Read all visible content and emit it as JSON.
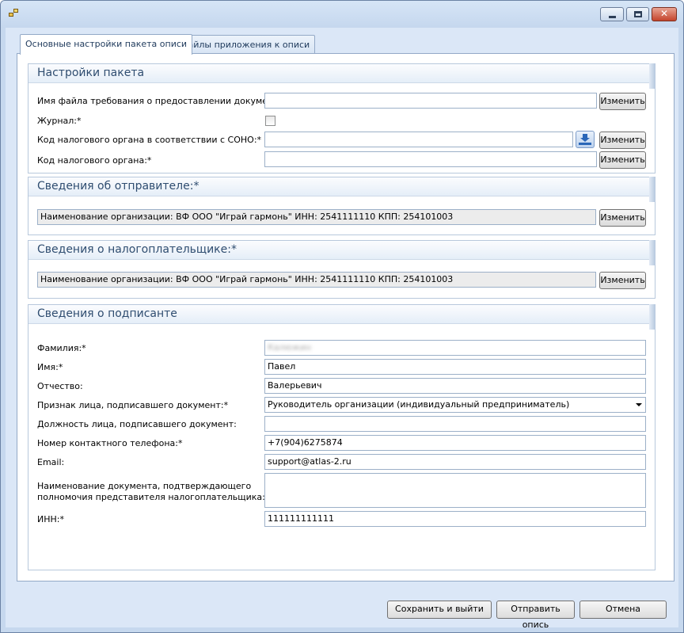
{
  "tabs": [
    "Основные настройки пакета описи",
    "Файлы приложения к описи"
  ],
  "package": {
    "title": "Настройки пакета",
    "fields": {
      "request_file": {
        "label": "Имя файла требования о предоставлении документов:",
        "value": ""
      },
      "journal": {
        "label": "Журнал:*",
        "checked": false
      },
      "tax_code_sono": {
        "label": "Код налогового органа в соответствии с  СОНО:*",
        "value": ""
      },
      "tax_code": {
        "label": "Код налогового органа:*",
        "value": ""
      }
    }
  },
  "sender": {
    "title": "Сведения об отправителе:*",
    "value": "Наименование организации: ВФ ООО \"Играй гармонь\" ИНН: 2541111110 КПП: 254101003"
  },
  "taxpayer": {
    "title": "Сведения о налогоплательщике:*",
    "value": "Наименование организации: ВФ ООО \"Играй гармонь\" ИНН: 2541111110 КПП: 254101003"
  },
  "signer": {
    "title": "Сведения о подписанте",
    "fields": {
      "lastname": {
        "label": "Фамилия:*",
        "value": "Калюжин"
      },
      "firstname": {
        "label": "Имя:*",
        "value": "Павел"
      },
      "patronymic": {
        "label": "Отчество:",
        "value": "Валерьевич"
      },
      "sign_type": {
        "label": "Признак лица, подписавшего документ:*",
        "value": "Руководитель организации (индивидуальный предприниматель)"
      },
      "position": {
        "label": "Должность лица, подписавшего документ:",
        "value": ""
      },
      "phone": {
        "label": "Номер контактного телефона:*",
        "value": "+7(904)6275874"
      },
      "email": {
        "label": "Email:",
        "value": "support@atlas-2.ru"
      },
      "authority_doc": {
        "label1": "Наименование документа, подтверждающего",
        "label2": "полномочия представителя налогоплательщика:",
        "value": ""
      },
      "inn": {
        "label": "ИНН:*",
        "value": "111111111111"
      }
    }
  },
  "buttons": {
    "change": "Изменить",
    "save_exit": "Сохранить и выйти",
    "send": "Отправить опись",
    "cancel": "Отмена"
  }
}
